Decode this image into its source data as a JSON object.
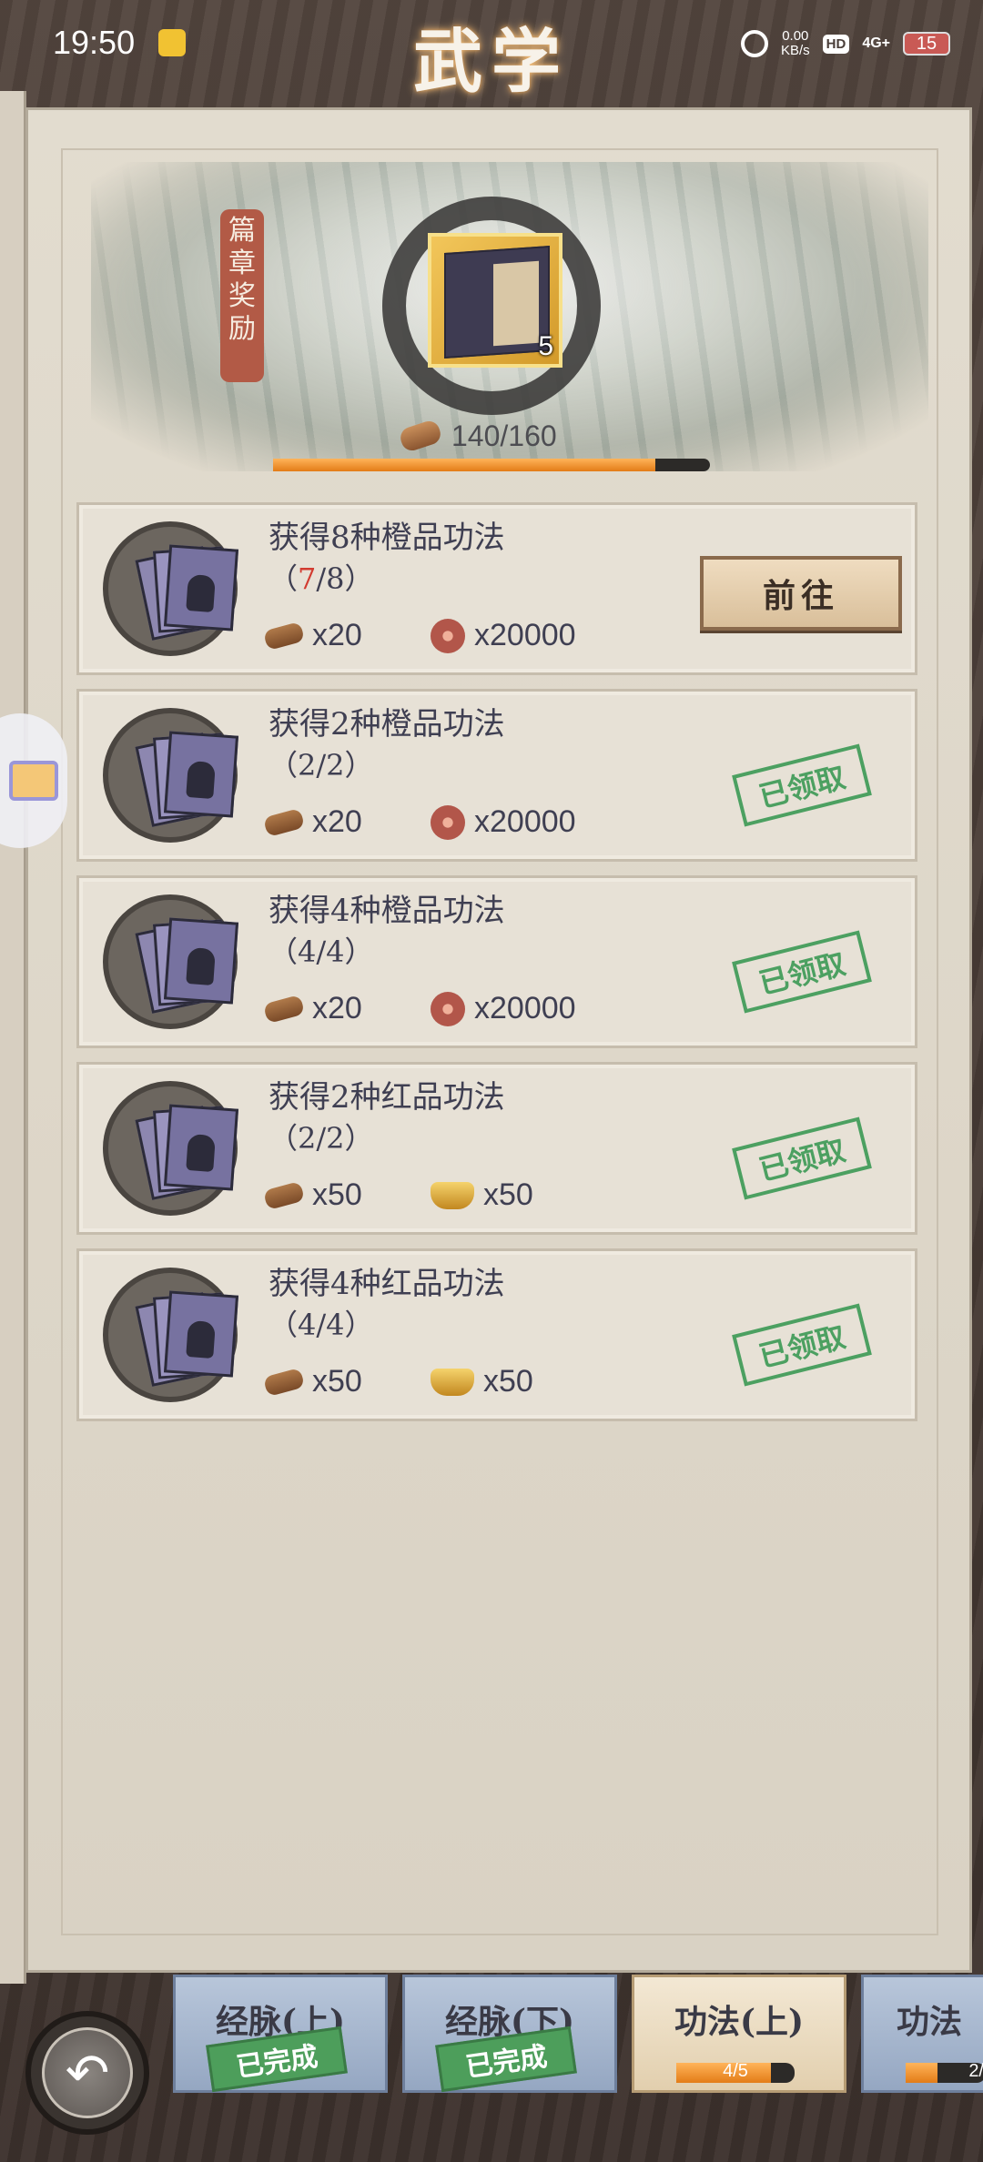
{
  "status_bar": {
    "time": "19:50",
    "net_speed_value": "0.00",
    "net_speed_unit": "KB/s",
    "hd": "HD",
    "signal": "4G+",
    "battery": "15"
  },
  "header": {
    "title": "武学"
  },
  "chapter_reward": {
    "tag_lines": [
      "篇",
      "章",
      "奖",
      "励"
    ],
    "item_count": "5",
    "progress_text": "140/160",
    "progress_fraction": 0.875
  },
  "tasks": [
    {
      "title": "获得8种橙品功法",
      "progress_open": "（",
      "progress_current": "7",
      "progress_rest": "/8）",
      "reward1": "x20",
      "reward2": "x20000",
      "reward2_icon": "copper-coin-icon",
      "action": "前往",
      "status": "in-progress"
    },
    {
      "title": "获得2种橙品功法",
      "progress": "（2/2）",
      "reward1": "x20",
      "reward2": "x20000",
      "reward2_icon": "copper-coin-icon",
      "stamp": "已领取",
      "status": "claimed"
    },
    {
      "title": "获得4种橙品功法",
      "progress": "（4/4）",
      "reward1": "x20",
      "reward2": "x20000",
      "reward2_icon": "copper-coin-icon",
      "stamp": "已领取",
      "status": "claimed"
    },
    {
      "title": "获得2种红品功法",
      "progress": "（2/2）",
      "reward1": "x50",
      "reward2": "x50",
      "reward2_icon": "gold-ingot-icon",
      "stamp": "已领取",
      "status": "claimed"
    },
    {
      "title": "获得4种红品功法",
      "progress": "（4/4）",
      "reward1": "x50",
      "reward2": "x50",
      "reward2_icon": "gold-ingot-icon",
      "stamp": "已领取",
      "status": "claimed"
    }
  ],
  "bottom_tabs": [
    {
      "label": "经脉(上)",
      "stamp": "已完成"
    },
    {
      "label": "经脉(下)",
      "stamp": "已完成"
    },
    {
      "label": "功法(上)",
      "progress_text": "4/5",
      "progress_fraction": 0.8,
      "active": true
    },
    {
      "label": "功法",
      "progress_text": "2/",
      "progress_fraction": 0.4
    }
  ]
}
